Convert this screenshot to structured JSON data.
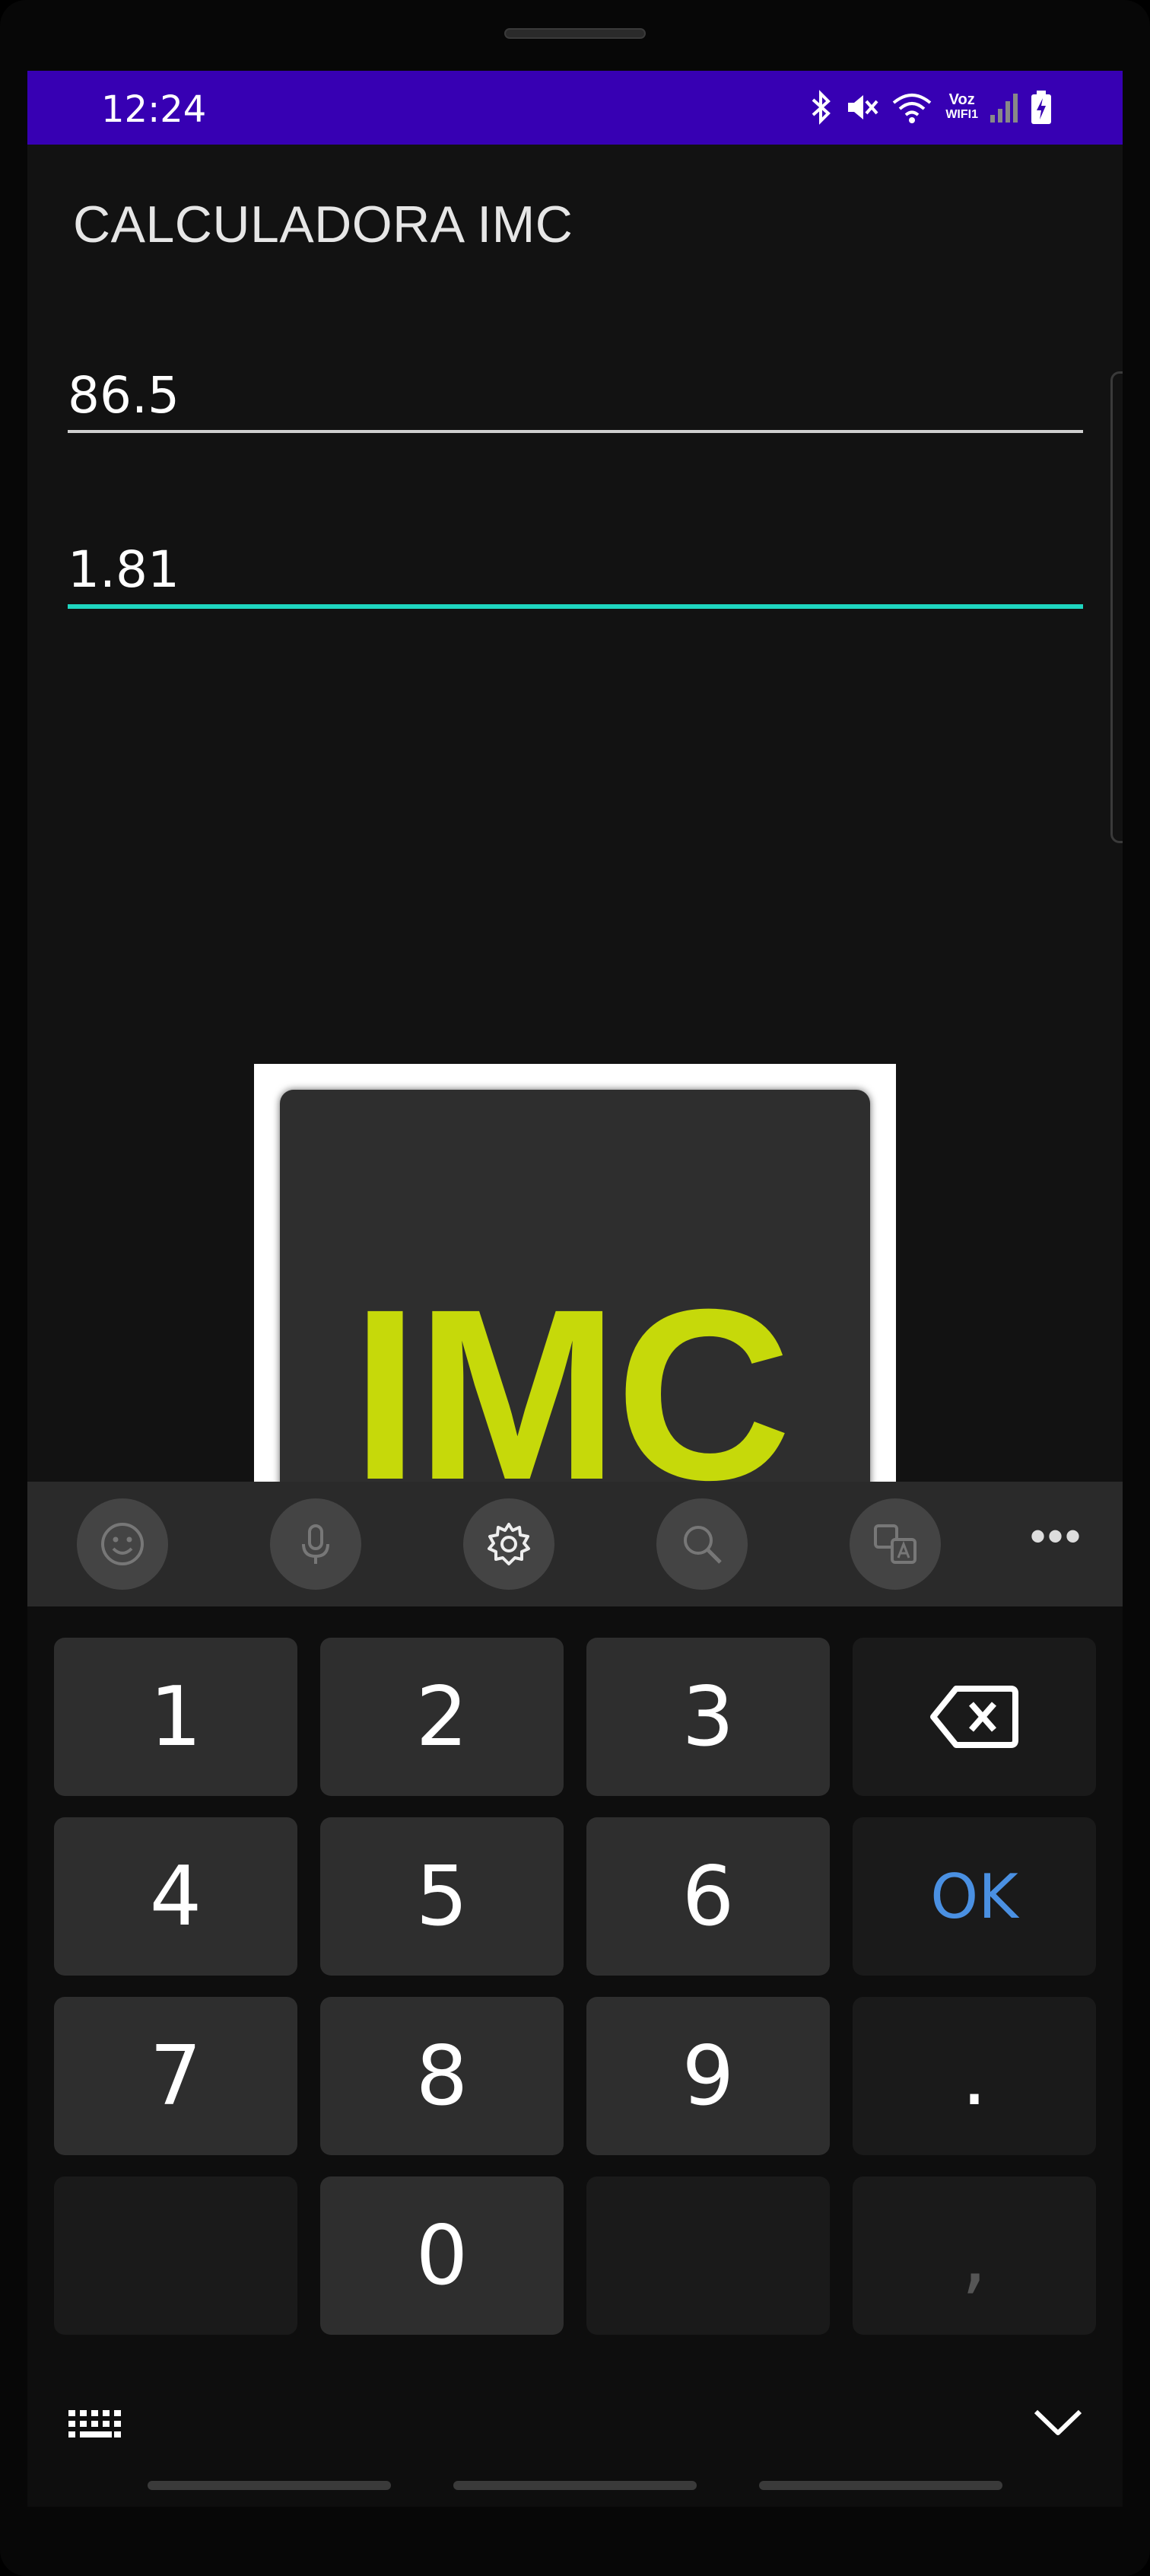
{
  "status": {
    "time": "12:24",
    "voz": "Voz",
    "wifi_label": "WIFI1"
  },
  "app": {
    "title": "CALCULADORA IMC"
  },
  "inputs": {
    "weight_value": "86.5",
    "height_value": "1.81"
  },
  "image": {
    "logo_text": "IMC"
  },
  "keyboard": {
    "toolbar": [
      "emoji-icon",
      "mic-icon",
      "settings-icon",
      "search-icon",
      "translate-icon",
      "more-icon"
    ],
    "more": "•••",
    "keys": {
      "k1": "1",
      "k2": "2",
      "k3": "3",
      "k4": "4",
      "k5": "5",
      "k6": "6",
      "ok": "OK",
      "k7": "7",
      "k8": "8",
      "k9": "9",
      "dot": ".",
      "k0": "0",
      "comma": ","
    }
  },
  "colors": {
    "statusbar": "#3700b3",
    "accent": "#1fd6c0",
    "logo_text": "#c6d90a",
    "ok_key": "#4a90e2"
  }
}
